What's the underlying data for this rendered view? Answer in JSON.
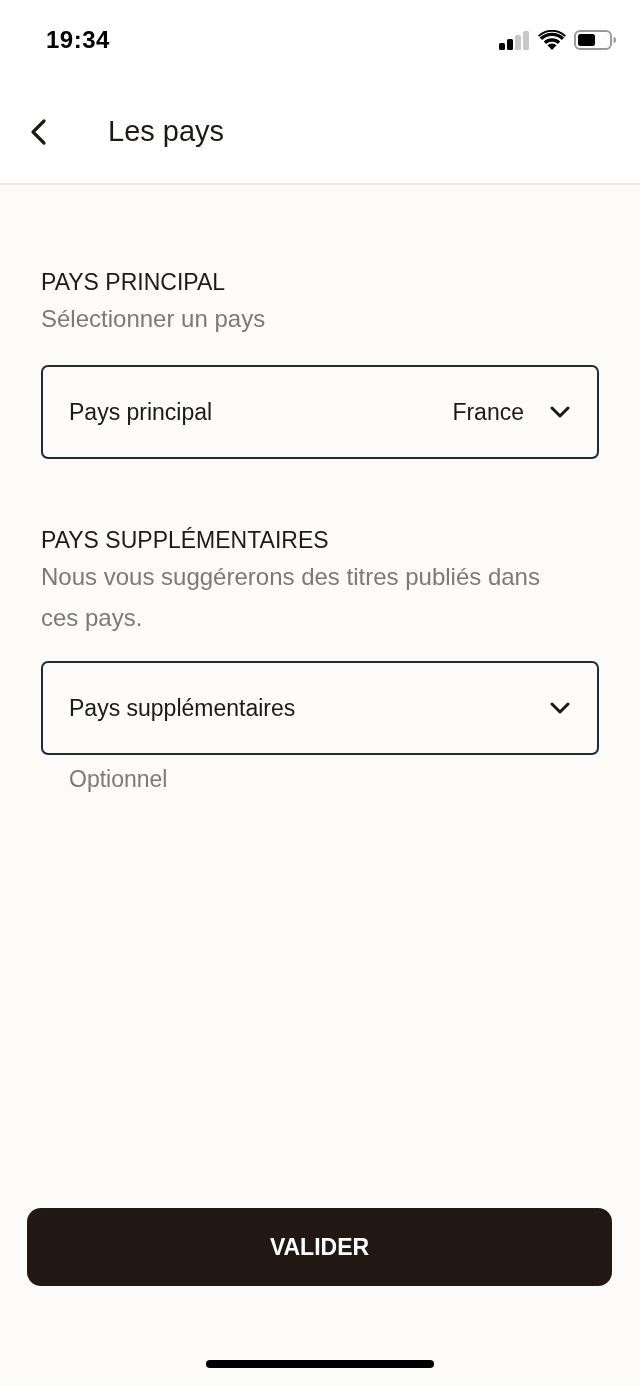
{
  "status_bar": {
    "time": "19:34"
  },
  "header": {
    "title": "Les pays"
  },
  "sections": [
    {
      "title": "PAYS PRINCIPAL",
      "description": "Sélectionner un pays",
      "select": {
        "label": "Pays principal",
        "value": "France"
      }
    },
    {
      "title": "PAYS SUPPLÉMENTAIRES",
      "description": "Nous vous suggérerons des titres publiés dans ces pays.",
      "select": {
        "label": "Pays supplémentaires"
      },
      "helper": "Optionnel"
    }
  ],
  "submit_button": {
    "label": "VALIDER"
  }
}
